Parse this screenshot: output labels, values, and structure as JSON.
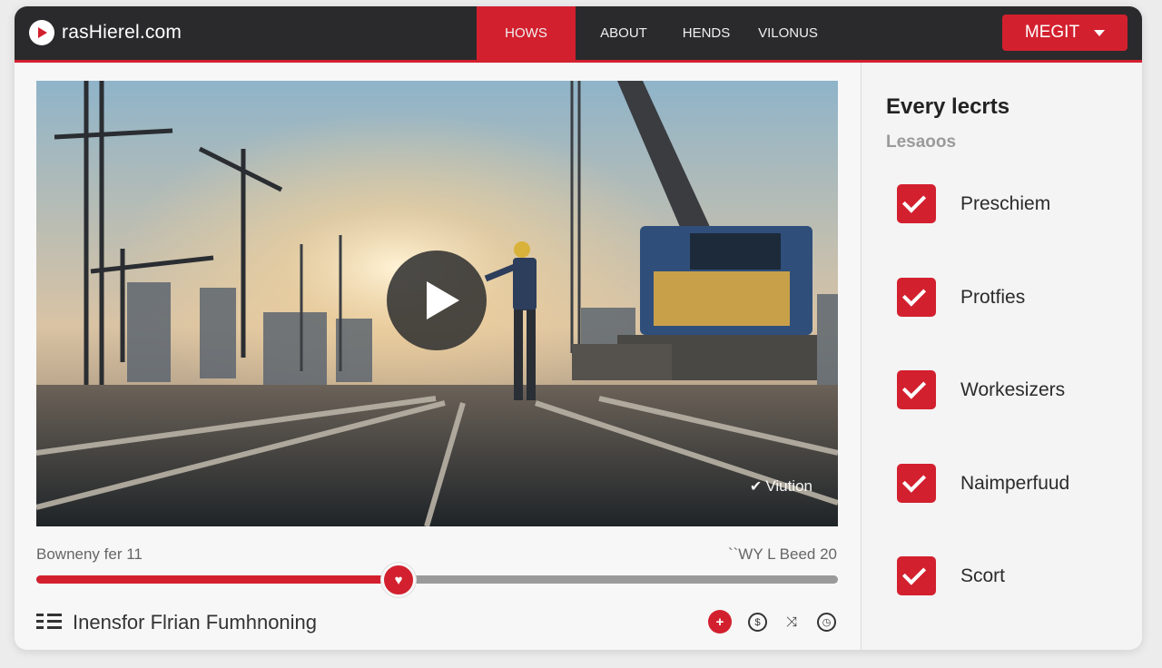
{
  "header": {
    "logo_text": "rasHierel.com",
    "nav": [
      "HOWS",
      "ABOUT",
      "HENDS",
      "VILONUS"
    ],
    "menu_label": "MEGIT"
  },
  "video": {
    "watermark": "Viution",
    "time_left": "Bowneny fer 11",
    "time_right": "``WY L Beed 20",
    "progress_fraction": 0.452,
    "title": "Inensfor Flrian Fumhnoning"
  },
  "sidebar": {
    "title": "Every lecrts",
    "subtitle": "Lesaoos",
    "items": [
      {
        "label": "Preschiem",
        "checked": true
      },
      {
        "label": "Protfies",
        "checked": true
      },
      {
        "label": "Workesizers",
        "checked": true
      },
      {
        "label": "Naimperfuud",
        "checked": true
      },
      {
        "label": "Scort",
        "checked": true
      }
    ]
  },
  "colors": {
    "accent": "#d3202e",
    "header_bg": "#2a2a2c"
  },
  "icons": [
    "play-logo-icon",
    "caret-down-icon",
    "play-icon",
    "verified-icon",
    "heart-icon",
    "list-icon",
    "plus-icon",
    "dollar-icon",
    "share-icon",
    "clock-icon",
    "checkbox-icon"
  ]
}
